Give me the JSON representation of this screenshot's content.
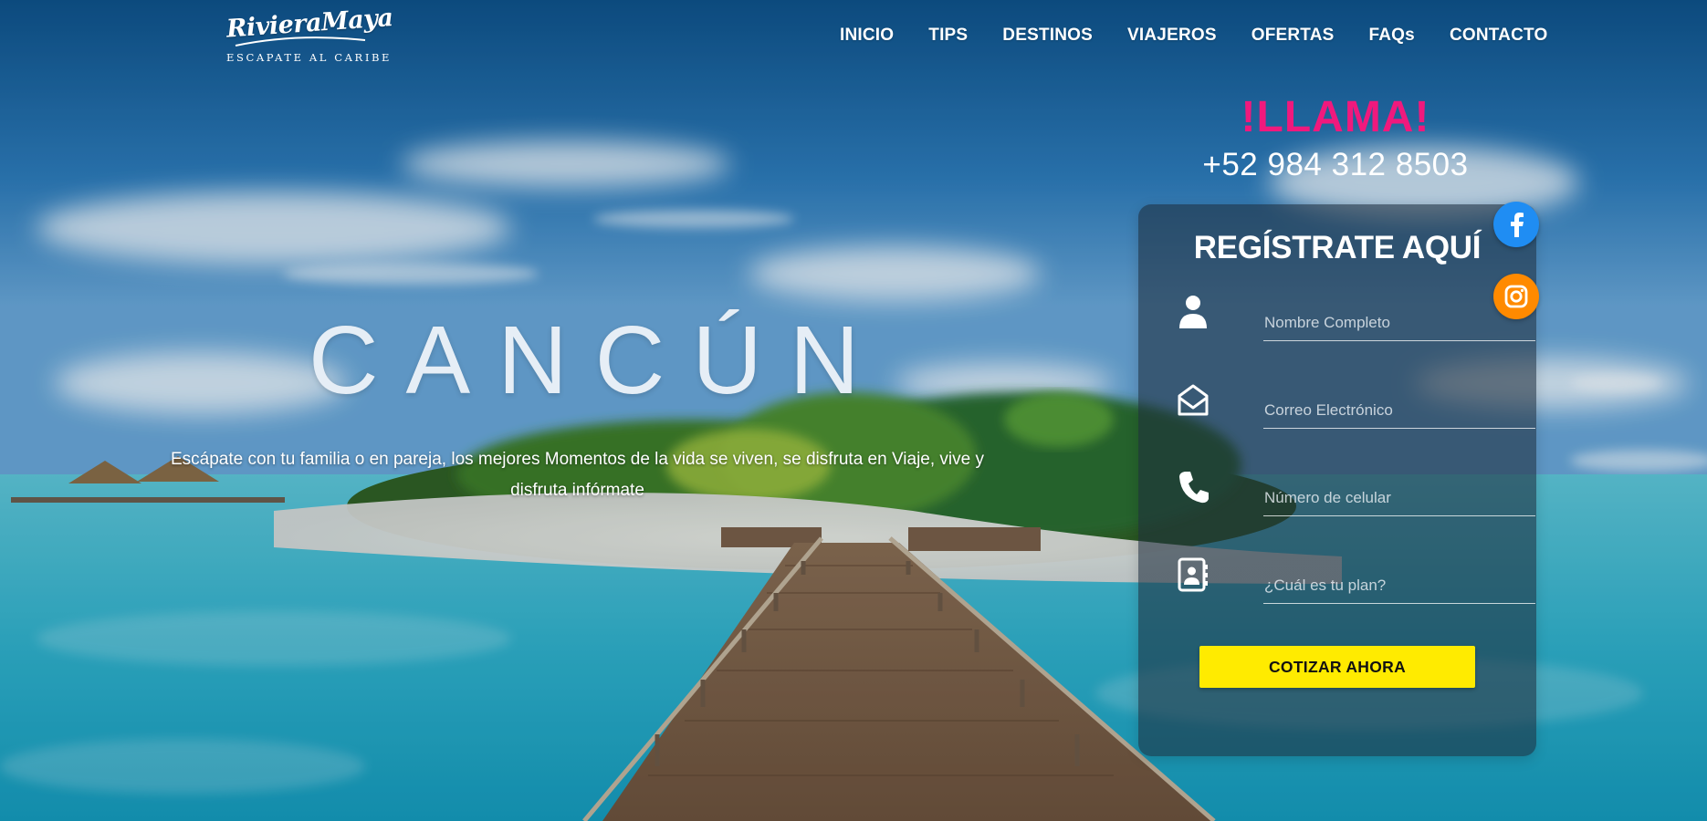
{
  "logo": {
    "script": "RivieraMaya",
    "tagline": "ESCAPATE AL CARIBE"
  },
  "nav": {
    "items": [
      "INICIO",
      "TIPS",
      "DESTINOS",
      "VIAJEROS",
      "OFERTAS",
      "FAQs",
      "CONTACTO"
    ]
  },
  "hero": {
    "title": "CANCÚN",
    "subtitle": "Escápate con tu familia o en pareja, los mejores Momentos de la vida se viven, se disfruta en Viaje, vive y disfruta infórmate"
  },
  "call": {
    "heading": "!LLAMA!",
    "phone": "+52 984 312 8503"
  },
  "form": {
    "title": "REGÍSTRATE AQUÍ",
    "fields": [
      {
        "placeholder": "Nombre Completo",
        "value": "",
        "icon": "user-icon"
      },
      {
        "placeholder": "Correo Electrónico",
        "value": "",
        "icon": "envelope-open-icon"
      },
      {
        "placeholder": "Número de celular",
        "value": "",
        "icon": "phone-icon"
      },
      {
        "placeholder": "¿Cuál es tu plan?",
        "value": "",
        "icon": "address-book-icon"
      }
    ],
    "submit_label": "COTIZAR AHORA"
  },
  "social": {
    "facebook_icon": "facebook-icon",
    "instagram_icon": "instagram-icon"
  },
  "colors": {
    "accent_pink": "#f0197d",
    "button_yellow": "#ffeb00",
    "facebook_blue": "#1f8df3",
    "instagram_orange": "#ff8a00",
    "panel_bg": "rgba(30,45,60,0.58)"
  }
}
